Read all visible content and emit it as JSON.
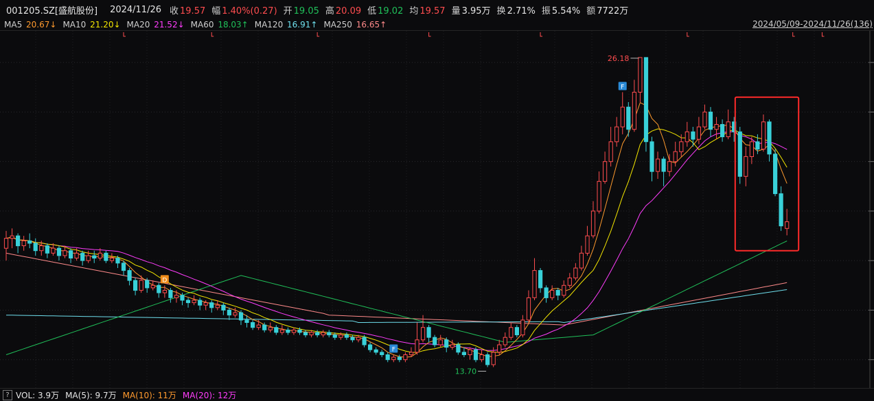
{
  "quote": {
    "code": "001205.SZ[盛航股份]",
    "date": "2024/11/26",
    "close_label": "收",
    "close": "19.57",
    "change_label": "幅",
    "change": "1.40%(0.27)",
    "open_label": "开",
    "open": "19.05",
    "high_label": "高",
    "high": "20.09",
    "low_label": "低",
    "low": "19.02",
    "avg_label": "均",
    "avg": "19.57",
    "volume_label": "量",
    "volume": "3.95万",
    "turnover_label": "换",
    "turnover": "2.71%",
    "amplitude_label": "振",
    "amplitude": "5.54%",
    "amount_label": "额",
    "amount": "7722万"
  },
  "ma": [
    {
      "name": "MA5",
      "value": "20.67↓",
      "color": "#ff9a2e"
    },
    {
      "name": "MA10",
      "value": "21.20↓",
      "color": "#f4e600"
    },
    {
      "name": "MA20",
      "value": "21.52↓",
      "color": "#ff3dfc"
    },
    {
      "name": "MA60",
      "value": "18.03↑",
      "color": "#20c15a"
    },
    {
      "name": "MA120",
      "value": "16.91↑",
      "color": "#6fe0ee"
    },
    {
      "name": "MA250",
      "value": "16.65↑",
      "color": "#ff8a8a"
    }
  ],
  "range_label": "2024/05/09-2024/11/26(136)",
  "volume_bar": {
    "help_icon": "?",
    "vol": "VOL: 3.9万",
    "ma5": "MA(5): 9.7万",
    "ma10": "MA(10): 11万",
    "ma20": "MA(20): 12万",
    "colors": {
      "ma10": "#ff9a2e",
      "ma20": "#ff3dfc"
    }
  },
  "chart_data": {
    "type": "candlestick",
    "colors": {
      "up": "#ff4d4f",
      "down": "#39d0d8",
      "highlight": "#ff2a2a"
    },
    "ylim": [
      13.3,
      27.0
    ],
    "price_levels": [
      26,
      24,
      22,
      20,
      18,
      16,
      14
    ],
    "annotations": [
      {
        "text": "26.18",
        "kind": "high",
        "index": 108
      },
      {
        "text": "13.70",
        "kind": "low",
        "index": 82
      },
      {
        "text": "D",
        "kind": "badge",
        "index": 27,
        "color": "#f08c1a"
      },
      {
        "text": "F",
        "kind": "badge",
        "index": 105,
        "color": "#2a8ad6"
      },
      {
        "text": "F",
        "kind": "badge",
        "index": 66,
        "color": "#2a8ad6"
      }
    ],
    "top_markers": [
      20,
      35,
      53,
      72,
      91,
      116,
      134,
      139,
      153,
      160,
      165,
      171,
      177,
      179,
      183,
      186,
      190
    ],
    "ohlc": [
      [
        18.5,
        18.9,
        19.2,
        18.0
      ],
      [
        18.9,
        19.0,
        19.3,
        18.5
      ],
      [
        19.0,
        18.6,
        19.1,
        18.3
      ],
      [
        18.6,
        18.8,
        19.0,
        18.4
      ],
      [
        18.8,
        18.7,
        19.1,
        18.5
      ],
      [
        18.7,
        18.4,
        18.9,
        18.2
      ],
      [
        18.4,
        18.6,
        18.8,
        18.2
      ],
      [
        18.6,
        18.3,
        18.7,
        18.1
      ],
      [
        18.3,
        18.5,
        18.7,
        18.2
      ],
      [
        18.5,
        18.2,
        18.6,
        18.0
      ],
      [
        18.2,
        18.4,
        18.6,
        18.1
      ],
      [
        18.4,
        18.1,
        18.5,
        17.9
      ],
      [
        18.1,
        18.3,
        18.5,
        18.0
      ],
      [
        18.3,
        18.0,
        18.4,
        17.8
      ],
      [
        18.0,
        18.2,
        18.4,
        17.9
      ],
      [
        18.2,
        18.1,
        18.4,
        17.9
      ],
      [
        18.1,
        18.3,
        18.5,
        18.0
      ],
      [
        18.3,
        18.0,
        18.4,
        17.9
      ],
      [
        18.0,
        18.1,
        18.3,
        17.9
      ],
      [
        18.1,
        17.9,
        18.2,
        17.7
      ],
      [
        17.9,
        17.6,
        18.0,
        17.4
      ],
      [
        17.6,
        17.2,
        17.7,
        17.0
      ],
      [
        17.2,
        16.8,
        17.3,
        16.6
      ],
      [
        16.8,
        17.2,
        17.4,
        16.7
      ],
      [
        17.2,
        16.9,
        17.3,
        16.7
      ],
      [
        16.9,
        17.0,
        17.2,
        16.8
      ],
      [
        17.0,
        16.7,
        17.1,
        16.5
      ],
      [
        16.7,
        16.8,
        17.0,
        16.5
      ],
      [
        16.8,
        16.5,
        16.9,
        16.3
      ],
      [
        16.5,
        16.6,
        16.8,
        16.3
      ],
      [
        16.6,
        16.4,
        16.7,
        16.2
      ],
      [
        16.4,
        16.3,
        16.5,
        16.1
      ],
      [
        16.3,
        16.4,
        16.6,
        16.2
      ],
      [
        16.4,
        16.2,
        16.5,
        16.0
      ],
      [
        16.2,
        16.3,
        16.4,
        16.0
      ],
      [
        16.3,
        16.1,
        16.4,
        15.9
      ],
      [
        16.1,
        16.2,
        16.4,
        16.0
      ],
      [
        16.2,
        16.0,
        16.3,
        15.8
      ],
      [
        16.0,
        15.8,
        16.1,
        15.6
      ],
      [
        15.8,
        15.9,
        16.1,
        15.7
      ],
      [
        15.9,
        15.6,
        16.0,
        15.4
      ],
      [
        15.6,
        15.5,
        15.8,
        15.3
      ],
      [
        15.5,
        15.3,
        15.6,
        15.2
      ],
      [
        15.3,
        15.4,
        15.6,
        15.2
      ],
      [
        15.4,
        15.2,
        15.5,
        15.1
      ],
      [
        15.2,
        15.3,
        15.5,
        15.1
      ],
      [
        15.3,
        15.1,
        15.4,
        15.0
      ],
      [
        15.1,
        15.2,
        15.4,
        15.0
      ],
      [
        15.2,
        15.1,
        15.3,
        15.0
      ],
      [
        15.1,
        15.2,
        15.3,
        15.0
      ],
      [
        15.2,
        15.1,
        15.3,
        15.0
      ],
      [
        15.1,
        15.0,
        15.2,
        14.9
      ],
      [
        15.0,
        15.1,
        15.2,
        14.9
      ],
      [
        15.1,
        15.0,
        15.2,
        14.9
      ],
      [
        15.0,
        15.1,
        15.2,
        14.9
      ],
      [
        15.1,
        15.0,
        15.2,
        14.9
      ],
      [
        15.0,
        14.9,
        15.1,
        14.8
      ],
      [
        14.9,
        15.0,
        15.1,
        14.8
      ],
      [
        15.0,
        14.9,
        15.1,
        14.8
      ],
      [
        14.9,
        14.8,
        15.0,
        14.7
      ],
      [
        14.8,
        14.9,
        15.0,
        14.7
      ],
      [
        14.9,
        14.6,
        15.0,
        14.5
      ],
      [
        14.6,
        14.4,
        14.7,
        14.3
      ],
      [
        14.4,
        14.3,
        14.5,
        14.2
      ],
      [
        14.3,
        14.2,
        14.4,
        14.1
      ],
      [
        14.2,
        14.0,
        14.3,
        13.9
      ],
      [
        14.0,
        14.1,
        14.2,
        13.9
      ],
      [
        14.1,
        14.0,
        14.2,
        13.9
      ],
      [
        14.0,
        14.2,
        14.3,
        13.9
      ],
      [
        14.2,
        14.3,
        14.5,
        14.1
      ],
      [
        14.3,
        14.8,
        15.5,
        14.2
      ],
      [
        14.8,
        15.3,
        15.8,
        14.7
      ],
      [
        15.3,
        14.9,
        15.4,
        14.7
      ],
      [
        14.9,
        14.6,
        15.0,
        14.5
      ],
      [
        14.6,
        14.8,
        15.0,
        14.5
      ],
      [
        14.8,
        14.5,
        14.9,
        14.3
      ],
      [
        14.5,
        14.6,
        14.8,
        14.4
      ],
      [
        14.6,
        14.3,
        14.7,
        14.2
      ],
      [
        14.3,
        14.2,
        14.5,
        14.1
      ],
      [
        14.2,
        14.4,
        14.5,
        14.0
      ],
      [
        14.4,
        14.0,
        14.5,
        13.9
      ],
      [
        14.0,
        14.2,
        14.4,
        13.9
      ],
      [
        14.2,
        13.8,
        14.3,
        13.7
      ],
      [
        13.8,
        14.3,
        14.5,
        13.7
      ],
      [
        14.3,
        14.6,
        14.8,
        14.2
      ],
      [
        14.6,
        14.9,
        15.1,
        14.5
      ],
      [
        14.9,
        15.3,
        15.5,
        14.8
      ],
      [
        15.3,
        15.0,
        15.4,
        14.9
      ],
      [
        15.0,
        15.6,
        15.8,
        14.9
      ],
      [
        15.6,
        16.5,
        16.8,
        15.5
      ],
      [
        16.5,
        17.6,
        18.1,
        16.4
      ],
      [
        17.6,
        16.9,
        17.7,
        16.7
      ],
      [
        16.9,
        16.5,
        17.0,
        16.3
      ],
      [
        16.5,
        16.8,
        17.0,
        16.4
      ],
      [
        16.8,
        16.6,
        16.9,
        16.4
      ],
      [
        16.6,
        17.0,
        17.2,
        16.5
      ],
      [
        17.0,
        17.3,
        17.5,
        16.9
      ],
      [
        17.3,
        17.7,
        17.9,
        17.2
      ],
      [
        17.7,
        18.3,
        18.6,
        17.6
      ],
      [
        18.3,
        19.0,
        19.4,
        18.2
      ],
      [
        19.0,
        20.0,
        20.4,
        18.9
      ],
      [
        20.0,
        21.2,
        21.6,
        19.9
      ],
      [
        21.2,
        22.0,
        22.4,
        21.1
      ],
      [
        22.0,
        22.8,
        23.4,
        21.8
      ],
      [
        22.8,
        23.4,
        23.8,
        22.6
      ],
      [
        23.4,
        24.2,
        24.8,
        23.1
      ],
      [
        24.2,
        23.3,
        24.4,
        23.0
      ],
      [
        23.3,
        24.8,
        25.3,
        23.2
      ],
      [
        24.8,
        26.2,
        26.2,
        24.4
      ],
      [
        26.2,
        22.8,
        26.0,
        22.4
      ],
      [
        22.8,
        21.6,
        23.0,
        21.2
      ],
      [
        21.6,
        22.1,
        22.4,
        21.3
      ],
      [
        22.1,
        21.6,
        22.2,
        21.0
      ],
      [
        21.6,
        22.0,
        22.3,
        21.4
      ],
      [
        22.0,
        22.4,
        22.8,
        21.8
      ],
      [
        22.4,
        22.8,
        23.1,
        22.2
      ],
      [
        22.8,
        23.2,
        23.6,
        22.6
      ],
      [
        23.2,
        22.9,
        23.4,
        22.6
      ],
      [
        22.9,
        23.4,
        23.8,
        22.7
      ],
      [
        23.4,
        24.0,
        24.3,
        23.3
      ],
      [
        24.0,
        23.3,
        24.2,
        23.0
      ],
      [
        23.3,
        23.5,
        23.8,
        22.9
      ],
      [
        23.5,
        23.0,
        23.7,
        22.8
      ],
      [
        23.0,
        23.6,
        24.1,
        22.9
      ],
      [
        23.6,
        23.2,
        23.8,
        22.8
      ],
      [
        23.2,
        21.4,
        23.4,
        21.1
      ],
      [
        21.4,
        22.2,
        22.6,
        21.0
      ],
      [
        22.2,
        22.8,
        23.0,
        21.9
      ],
      [
        22.8,
        22.5,
        23.1,
        22.3
      ],
      [
        22.5,
        23.6,
        23.9,
        22.4
      ],
      [
        23.6,
        22.3,
        23.7,
        22.0
      ],
      [
        22.3,
        20.7,
        22.5,
        20.6
      ],
      [
        20.7,
        19.4,
        21.0,
        19.2
      ],
      [
        19.3,
        19.57,
        20.09,
        19.02
      ]
    ]
  }
}
